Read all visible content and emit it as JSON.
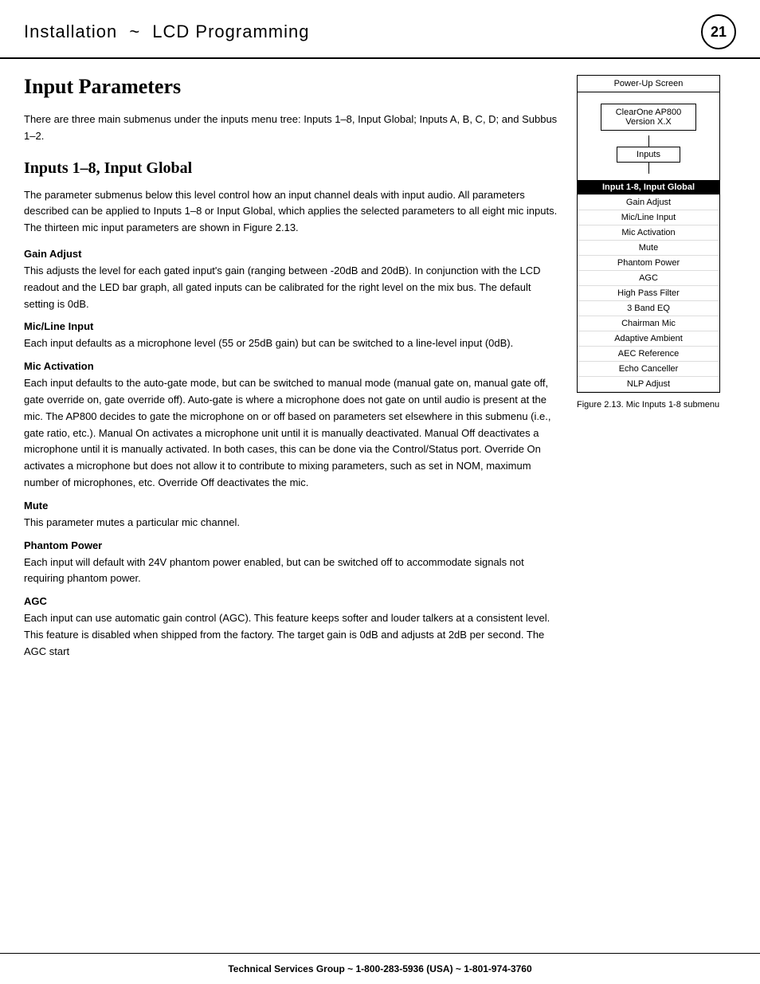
{
  "header": {
    "title": "Installation",
    "tilde": "~",
    "subtitle": "LCD Programming",
    "page_number": "21"
  },
  "page_title": "Input Parameters",
  "intro_text": "There are three main submenus under the inputs menu tree: Inputs 1–8, Input Global; Inputs A, B, C, D; and Subbus 1–2.",
  "section1": {
    "title": "Inputs 1–8, Input Global",
    "description": "The parameter submenus below this level control how an input channel deals with input audio. All parameters described can be applied to Inputs 1–8 or Input Global, which applies the selected parameters to all eight mic inputs. The thirteen mic input parameters are shown in Figure 2.13."
  },
  "subsections": [
    {
      "title": "Gain Adjust",
      "text": "This adjusts the level for each gated input's gain (ranging between -20dB and 20dB). In conjunction with the LCD readout and the LED bar graph, all gated inputs can be calibrated for the right level on the mix bus. The default setting is 0dB."
    },
    {
      "title": "Mic/Line Input",
      "text": "Each input defaults as a microphone level (55 or 25dB gain) but can be switched to a line-level input (0dB)."
    },
    {
      "title": "Mic Activation",
      "text": "Each input defaults to the auto-gate mode, but can be switched to manual mode (manual gate on, manual gate off, gate override on, gate override off). Auto-gate is where a microphone does not gate on until audio is present at the mic. The AP800 decides to gate the microphone on or off based on parameters set elsewhere in this submenu (i.e., gate ratio, etc.). Manual On activates a microphone unit until it is manually deactivated. Manual Off deactivates a microphone until it is manually activated. In both cases, this can be done via the Control/Status port. Override On activates a microphone but does not allow it to contribute to mixing parameters, such as set in NOM, maximum number of microphones, etc. Override Off deactivates the mic."
    },
    {
      "title": "Mute",
      "text": "This parameter mutes a particular mic channel."
    },
    {
      "title": "Phantom Power",
      "text": "Each input will default with 24V phantom power enabled, but can be switched off to accommodate signals not requiring phantom power."
    },
    {
      "title": "AGC",
      "text": "Each input can use automatic gain control (AGC). This feature keeps softer and louder talkers at a consistent level. This feature is disabled when shipped from the factory. The target gain is 0dB and adjusts at 2dB per second. The AGC start"
    }
  ],
  "diagram": {
    "power_up_screen_label": "Power-Up Screen",
    "clearone_label": "ClearOne  AP800\nVersion X.X",
    "inputs_label": "Inputs",
    "highlighted_label": "Input 1-8, Input Global",
    "menu_items": [
      "Gain Adjust",
      "Mic/Line Input",
      "Mic Activation",
      "Mute",
      "Phantom Power",
      "AGC",
      "High Pass Filter",
      "3 Band EQ",
      "Chairman Mic",
      "Adaptive Ambient",
      "AEC Reference",
      "Echo Canceller",
      "NLP Adjust"
    ],
    "figure_caption": "Figure 2.13.  Mic Inputs 1-8 submenu"
  },
  "footer": {
    "text": "Technical Services Group ~ 1-800-283-5936 (USA) ~ 1-801-974-3760"
  }
}
